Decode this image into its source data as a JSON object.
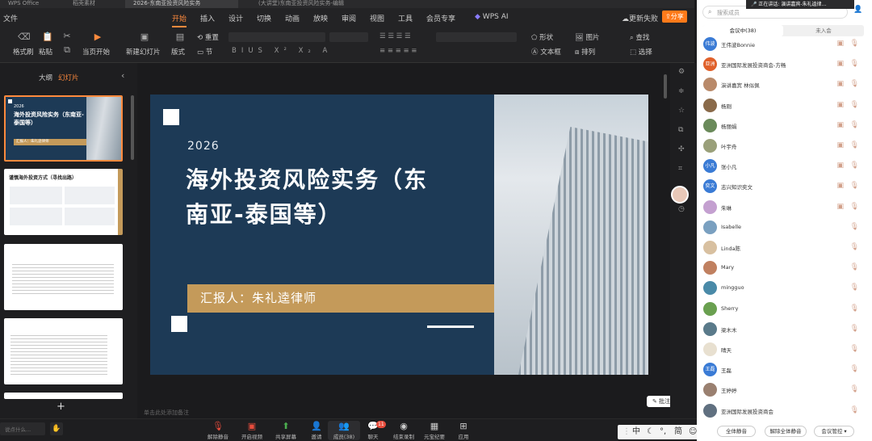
{
  "tabs": [
    {
      "label": "WPS Office"
    },
    {
      "label": "稻壳素材"
    },
    {
      "label": "2026-东南亚投资风险实务"
    },
    {
      "label": "(大讲堂)东南亚投资风险实务-编辑"
    }
  ],
  "ribbon": {
    "file": "文件",
    "tabs": [
      "开始",
      "插入",
      "设计",
      "切换",
      "动画",
      "放映",
      "审阅",
      "视图",
      "工具",
      "会员专享"
    ],
    "wps_ai": "WPS AI",
    "update": "更新失败",
    "share": "分享"
  },
  "toolbar": {
    "format_painter": "格式刷",
    "paste": "粘贴",
    "play": "当页开始",
    "new_slide": "新建幻灯片",
    "layout": "版式",
    "reset": "重置",
    "section": "节",
    "shape": "形状",
    "picture": "图片",
    "find": "查找",
    "textbox": "文本框",
    "arrange": "排列",
    "select": "选择"
  },
  "leftpane": {
    "outline": "大纲",
    "slides": "幻灯片",
    "add": "+"
  },
  "slide": {
    "year": "2026",
    "title": "海外投资风险实务（东南亚-泰国等）",
    "title_line1": "海外投资风险实务（东",
    "title_line2": "南亚-泰国等）",
    "presenter": "汇报人：朱礼逵律师",
    "thumb2_title": "谨慎海外投资方式（寻找出路）"
  },
  "notes_placeholder": "单击此处添加备注",
  "annotate": "批注",
  "chat_placeholder": "说点什么...",
  "bottom": [
    "解除静音",
    "开启视频",
    "共享屏幕",
    "邀请",
    "成员(38)",
    "聊天",
    "结束录制",
    "元宝纪要",
    "应用"
  ],
  "chat_badge": "11",
  "ime": [
    "中",
    "简"
  ],
  "panel": {
    "search_placeholder": "搜索成员",
    "speaking": "正在讲话: 演讲嘉宾-朱礼逵律...",
    "tab_in": "会议中(38)",
    "tab_out": "未入会",
    "members": [
      {
        "name": "王伟波Bonnie",
        "av": "伟波",
        "color": "#3a7bd5"
      },
      {
        "name": "亚洲国际发展投资商会-方畅",
        "av": "亚洲",
        "color": "#e0602a"
      },
      {
        "name": "演讲嘉宾 林似佩",
        "av": "",
        "color": "#b98a6a"
      },
      {
        "name": "杨刚",
        "av": "",
        "color": "#8a6a4a"
      },
      {
        "name": "杨丽娟",
        "av": "",
        "color": "#6a8a5a"
      },
      {
        "name": "叶宇舟",
        "av": "",
        "color": "#9aa07a"
      },
      {
        "name": "张小凡",
        "av": "小凡",
        "color": "#3a7bd5"
      },
      {
        "name": "志兴知识奕文",
        "av": "奕文",
        "color": "#3a7bd5"
      },
      {
        "name": "朱琳",
        "av": "",
        "color": "#c4a0d0"
      },
      {
        "name": "Isabelle",
        "av": "",
        "color": "#7aa0c0"
      },
      {
        "name": "Linda陈",
        "av": "",
        "color": "#d8c0a0"
      },
      {
        "name": "Mary",
        "av": "",
        "color": "#c08060"
      },
      {
        "name": "mingguo",
        "av": "",
        "color": "#4a8aa8"
      },
      {
        "name": "Sherry",
        "av": "",
        "color": "#6aa050"
      },
      {
        "name": "梁木木",
        "av": "",
        "color": "#5a7a8a"
      },
      {
        "name": "晴天",
        "av": "",
        "color": "#e8e0d0"
      },
      {
        "name": "王磊",
        "av": "王磊",
        "color": "#3a7bd5"
      },
      {
        "name": "王婷婷",
        "av": "",
        "color": "#9a8070"
      },
      {
        "name": "亚洲国际发展投资商会",
        "av": "",
        "color": "#607080"
      }
    ],
    "mute_all": "全体静音",
    "unmute_all": "解除全体静音",
    "manage": "会议管控"
  },
  "colors": {
    "accent": "#ff8a3d",
    "slide_bg": "#1d3a56",
    "band": "#c49a5a"
  }
}
